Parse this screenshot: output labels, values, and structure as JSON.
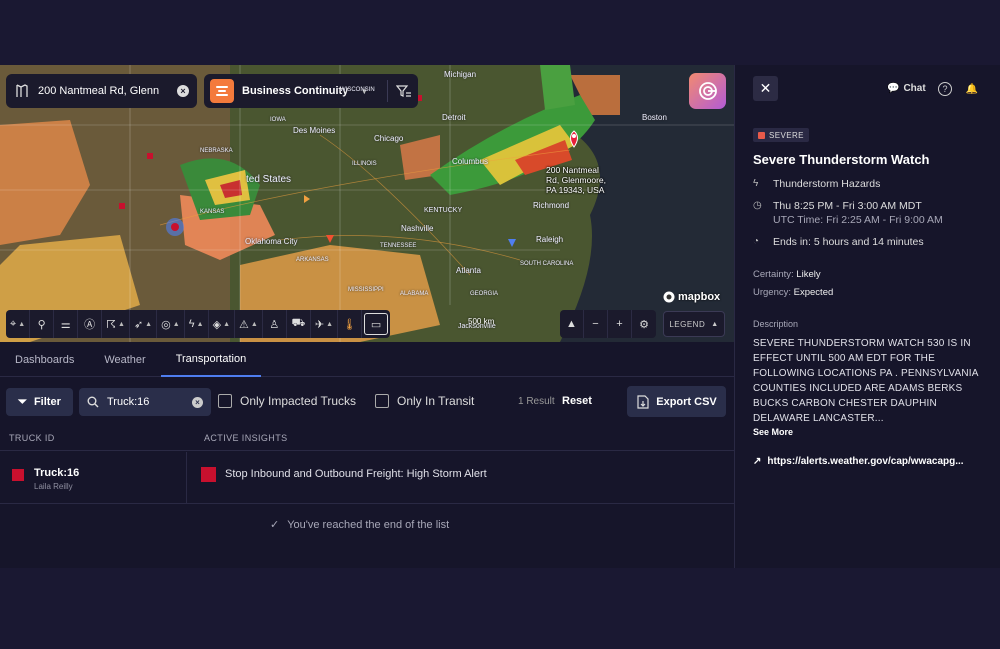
{
  "map": {
    "location_query": "200 Nantmeal Rd, Glenn",
    "context_selector": "Business Continuity",
    "pin_label_lines": [
      "200 Nantmeal",
      "Rd, Glenmoore,",
      "PA 19343, USA"
    ],
    "cities": [
      "Michigan",
      "Detroit",
      "Boston",
      "Des Moines",
      "Chicago",
      "Columbus",
      "ted States",
      "Richmond",
      "KENTUCKY",
      "Nashville",
      "Raleigh",
      "Oklahoma City",
      "Atlanta",
      "NEBRASKA",
      "IOWA",
      "WISCONSIN",
      "ILLINOIS",
      "KANSAS",
      "ARKANSAS",
      "TENNESSEE",
      "MISSISSIPPI",
      "ALABAMA",
      "GEORGIA",
      "SOUTH CAROLINA",
      "Jacksonville"
    ],
    "attribution": "mapbox",
    "scale": "500 km",
    "legend_label": "LEGEND",
    "toolbar_icons": [
      "location-icon",
      "route-icon",
      "sliders-icon",
      "wind-icon",
      "hurricane-icon",
      "plane-icon",
      "radar-icon",
      "lightning-icon",
      "layers-icon",
      "alert-icon",
      "walker-icon",
      "truck-icon",
      "flight-icon",
      "thermometer-icon",
      "ruler-icon"
    ]
  },
  "tabs": [
    {
      "label": "Dashboards",
      "active": false
    },
    {
      "label": "Weather",
      "active": false
    },
    {
      "label": "Transportation",
      "active": true
    }
  ],
  "filters": {
    "filter_label": "Filter",
    "search_value": "Truck:16",
    "only_impacted_label": "Only Impacted Trucks",
    "only_transit_label": "Only In Transit",
    "result_count": "1 Result",
    "reset_label": "Reset",
    "export_label": "Export CSV"
  },
  "table": {
    "columns": [
      "TRUCK ID",
      "ACTIVE INSIGHTS"
    ],
    "rows": [
      {
        "truck_id": "Truck:16",
        "driver": "Laila Reilly",
        "insight": "Stop Inbound and Outbound Freight: High Storm Alert",
        "status_color": "#c8102e"
      }
    ],
    "end_message": "You've reached the end of the list"
  },
  "panel": {
    "chat_label": "Chat",
    "severity": "SEVERE",
    "title": "Severe Thunderstorm Watch",
    "hazard": "Thunderstorm Hazards",
    "time_local": "Thu 8:25 PM - Fri 3:00 AM MDT",
    "time_utc": "UTC Time: Fri 2:25 AM - Fri 9:00 AM",
    "ends_in": "Ends in: 5 hours and 14 minutes",
    "certainty_label": "Certainty:",
    "certainty": "Likely",
    "urgency_label": "Urgency:",
    "urgency": "Expected",
    "description_label": "Description",
    "description": "SEVERE THUNDERSTORM WATCH 530 IS IN EFFECT UNTIL 500 AM EDT FOR THE FOLLOWING LOCATIONS PA . PENNSYLVANIA COUNTIES INCLUDED ARE ADAMS BERKS BUCKS CARBON CHESTER DAUPHIN DELAWARE LANCASTER...",
    "see_more": "See More",
    "link": "https://alerts.weather.gov/cap/wwacapg..."
  },
  "colors": {
    "accent": "#4f7ef0",
    "severe": "#c8102e",
    "brand_orange": "#f47a3c"
  }
}
